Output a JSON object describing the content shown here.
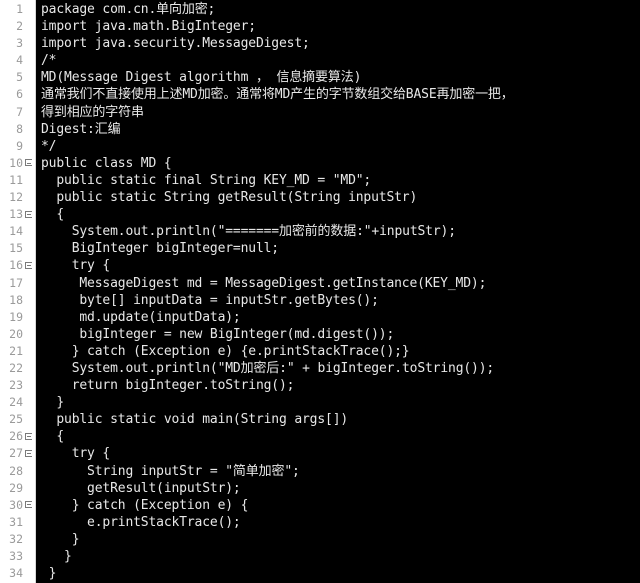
{
  "editor": {
    "language": "java",
    "theme": {
      "background": "#000000",
      "foreground": "#e8e8e8",
      "gutter_background": "#ffffff",
      "gutter_foreground": "#9a9a9a",
      "fold_marker_color": "#7a7a7a"
    },
    "total_lines": 34,
    "fold_marker_lines": [
      10,
      13,
      16,
      26,
      27,
      30
    ],
    "lines": [
      {
        "n": 1,
        "text": "package com.cn.单向加密;"
      },
      {
        "n": 2,
        "text": "import java.math.BigInteger;"
      },
      {
        "n": 3,
        "text": "import java.security.MessageDigest;"
      },
      {
        "n": 4,
        "text": "/*"
      },
      {
        "n": 5,
        "text": "MD(Message Digest algorithm ， 信息摘要算法)"
      },
      {
        "n": 6,
        "text": "通常我们不直接使用上述MD加密。通常将MD产生的字节数组交给BASE再加密一把，"
      },
      {
        "n": 7,
        "text": "得到相应的字符串"
      },
      {
        "n": 8,
        "text": "Digest:汇编"
      },
      {
        "n": 9,
        "text": "*/"
      },
      {
        "n": 10,
        "text": "public class MD {"
      },
      {
        "n": 11,
        "text": "  public static final String KEY_MD = \"MD\";"
      },
      {
        "n": 12,
        "text": "  public static String getResult(String inputStr)"
      },
      {
        "n": 13,
        "text": "  {"
      },
      {
        "n": 14,
        "text": "    System.out.println(\"=======加密前的数据:\"+inputStr);"
      },
      {
        "n": 15,
        "text": "    BigInteger bigInteger=null;"
      },
      {
        "n": 16,
        "text": "    try {"
      },
      {
        "n": 17,
        "text": "     MessageDigest md = MessageDigest.getInstance(KEY_MD);"
      },
      {
        "n": 18,
        "text": "     byte[] inputData = inputStr.getBytes();"
      },
      {
        "n": 19,
        "text": "     md.update(inputData);"
      },
      {
        "n": 20,
        "text": "     bigInteger = new BigInteger(md.digest());"
      },
      {
        "n": 21,
        "text": "    } catch (Exception e) {e.printStackTrace();}"
      },
      {
        "n": 22,
        "text": "    System.out.println(\"MD加密后:\" + bigInteger.toString());"
      },
      {
        "n": 23,
        "text": "    return bigInteger.toString();"
      },
      {
        "n": 24,
        "text": "  }"
      },
      {
        "n": 25,
        "text": "  public static void main(String args[])"
      },
      {
        "n": 26,
        "text": "  {"
      },
      {
        "n": 27,
        "text": "    try {"
      },
      {
        "n": 28,
        "text": "      String inputStr = \"简单加密\";"
      },
      {
        "n": 29,
        "text": "      getResult(inputStr);"
      },
      {
        "n": 30,
        "text": "    } catch (Exception e) {"
      },
      {
        "n": 31,
        "text": "      e.printStackTrace();"
      },
      {
        "n": 32,
        "text": "    }"
      },
      {
        "n": 33,
        "text": "   }"
      },
      {
        "n": 34,
        "text": " }"
      }
    ]
  }
}
